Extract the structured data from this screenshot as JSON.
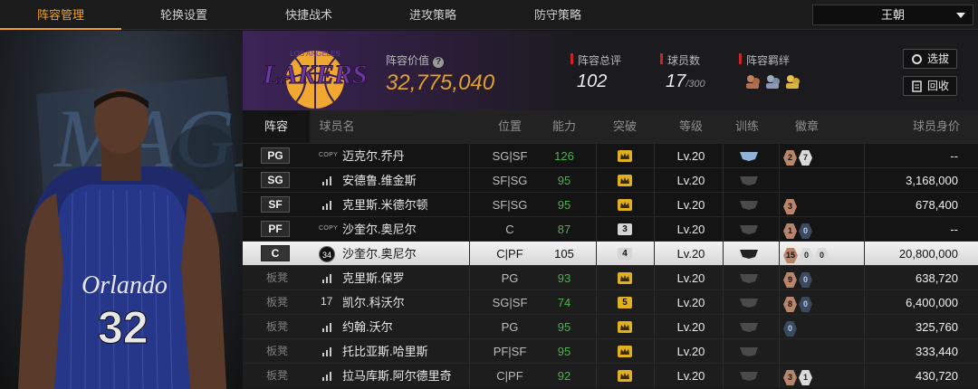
{
  "nav": {
    "tabs": [
      {
        "label": "阵容管理",
        "active": true
      },
      {
        "label": "轮换设置",
        "active": false
      },
      {
        "label": "快捷战术",
        "active": false
      },
      {
        "label": "进攻策略",
        "active": false
      },
      {
        "label": "防守策略",
        "active": false
      }
    ],
    "team_select": "王朝"
  },
  "portrait": {
    "jersey_team": "Orlando",
    "jersey_number": "32"
  },
  "summary": {
    "logo_text": "LAKERS",
    "logo_subtext": "LOS ANGELES",
    "value_label": "阵容价值",
    "value": "32,775,040",
    "rating_label": "阵容总评",
    "rating": "102",
    "player_count_label": "球员数",
    "player_count": "17",
    "player_count_max": "/300",
    "chemistry_label": "阵容羁绊",
    "btn_select": "选拔",
    "btn_recycle": "回收"
  },
  "table": {
    "headers": {
      "lineup": "阵容",
      "name": "球员名",
      "position": "位置",
      "ability": "能力",
      "breakthrough": "突破",
      "level": "等级",
      "training": "训练",
      "badges": "徽章",
      "salary": "球员身价"
    },
    "rows": [
      {
        "slot": "PG",
        "tag": "copy",
        "name": "迈克尔.乔丹",
        "position": "SG|SF",
        "ability": "126",
        "ability_color": "#4fb04f",
        "break": "crown",
        "level": "Lv.20",
        "train": "blue",
        "badges": [
          {
            "t": "2",
            "c": "bronze"
          },
          {
            "t": "7",
            "c": "light"
          }
        ],
        "salary": "--"
      },
      {
        "slot": "SG",
        "tag": "bars",
        "name": "安德鲁.维金斯",
        "position": "SF|SG",
        "ability": "95",
        "ability_color": "#4fb04f",
        "break": "crown",
        "level": "Lv.20",
        "train": "grey",
        "badges": [],
        "salary": "3,168,000"
      },
      {
        "slot": "SF",
        "tag": "bars",
        "name": "克里斯.米德尔顿",
        "position": "SF|SG",
        "ability": "95",
        "ability_color": "#4fb04f",
        "break": "crown",
        "level": "Lv.20",
        "train": "grey",
        "badges": [
          {
            "t": "3",
            "c": "bronze"
          }
        ],
        "salary": "678,400"
      },
      {
        "slot": "PF",
        "tag": "copy",
        "name": "沙奎尔.奥尼尔",
        "position": "C",
        "ability": "87",
        "ability_color": "#4fb04f",
        "break": "3",
        "level": "Lv.20",
        "train": "grey",
        "badges": [
          {
            "t": "1",
            "c": "bronze"
          },
          {
            "t": "0",
            "c": "blue"
          }
        ],
        "salary": "--"
      },
      {
        "slot": "C",
        "tag": "jersey",
        "jersey": "34",
        "name": "沙奎尔.奥尼尔",
        "position": "C|PF",
        "ability": "105",
        "ability_color": "#111111",
        "break": "4",
        "level": "Lv.20",
        "train": "dark",
        "badges": [
          {
            "t": "15",
            "c": "bronze"
          },
          {
            "t": "0",
            "c": "light"
          },
          {
            "t": "0",
            "c": "light"
          }
        ],
        "salary": "20,800,000",
        "selected": true
      },
      {
        "slot": "板凳",
        "tag": "bars",
        "name": "克里斯.保罗",
        "position": "PG",
        "ability": "93",
        "ability_color": "#4fb04f",
        "break": "crown",
        "level": "Lv.20",
        "train": "grey",
        "badges": [
          {
            "t": "9",
            "c": "bronze"
          },
          {
            "t": "0",
            "c": "blue"
          }
        ],
        "salary": "638,720"
      },
      {
        "slot": "板凳",
        "tag": "num",
        "tagnum": "17",
        "name": "凯尔.科沃尔",
        "position": "SG|SF",
        "ability": "74",
        "ability_color": "#4fb04f",
        "break": "5",
        "level": "Lv.20",
        "train": "grey",
        "badges": [
          {
            "t": "8",
            "c": "bronze"
          },
          {
            "t": "0",
            "c": "blue"
          }
        ],
        "salary": "6,400,000"
      },
      {
        "slot": "板凳",
        "tag": "bars",
        "name": "约翰.沃尔",
        "position": "PG",
        "ability": "95",
        "ability_color": "#4fb04f",
        "break": "crown",
        "level": "Lv.20",
        "train": "grey",
        "badges": [
          {
            "t": "0",
            "c": "blue"
          }
        ],
        "salary": "325,760"
      },
      {
        "slot": "板凳",
        "tag": "bars",
        "name": "托比亚斯.哈里斯",
        "position": "PF|SF",
        "ability": "95",
        "ability_color": "#4fb04f",
        "break": "crown",
        "level": "Lv.20",
        "train": "grey",
        "badges": [],
        "salary": "333,440"
      },
      {
        "slot": "板凳",
        "tag": "bars",
        "name": "拉马库斯.阿尔德里奇",
        "position": "C|PF",
        "ability": "92",
        "ability_color": "#4fb04f",
        "break": "crown",
        "level": "Lv.20",
        "train": "grey",
        "badges": [
          {
            "t": "3",
            "c": "bronze"
          },
          {
            "t": "1",
            "c": "light"
          }
        ],
        "salary": "430,720"
      }
    ]
  }
}
